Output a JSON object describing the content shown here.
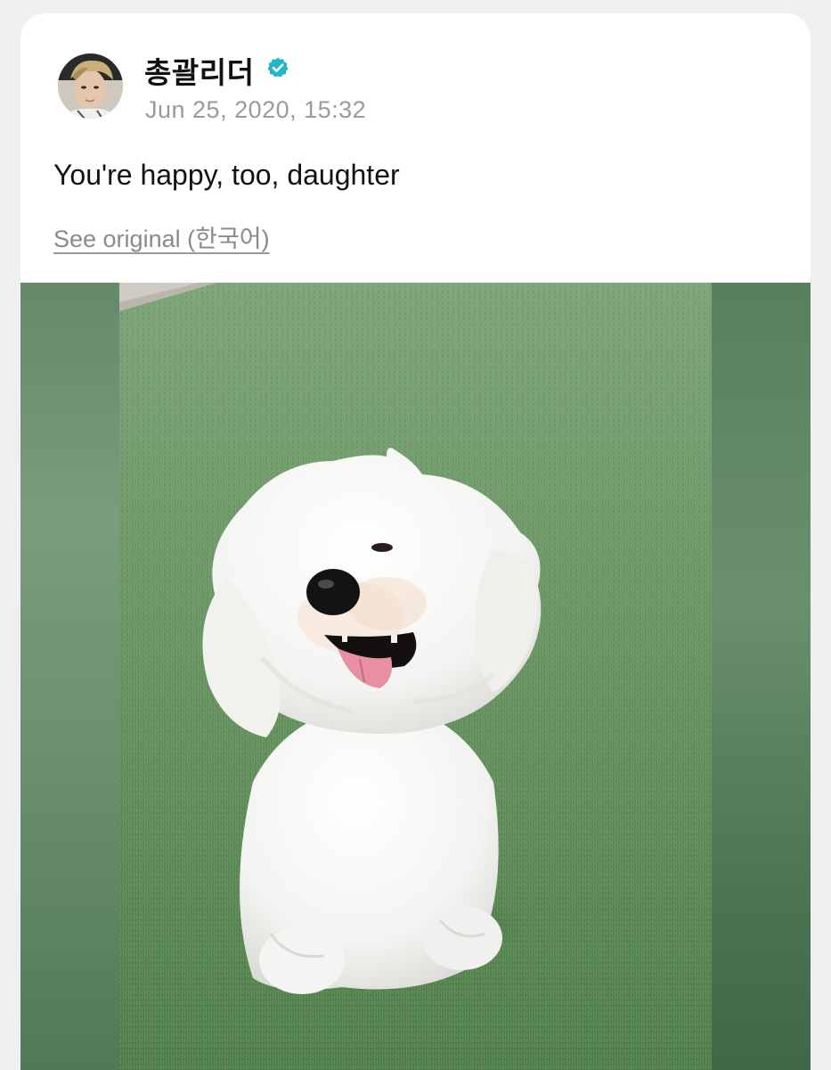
{
  "post": {
    "author_name": "총괄리더",
    "verified_icon": "verified-badge-icon",
    "timestamp": "Jun 25, 2020, 15:32",
    "text": "You're happy, too, daughter",
    "see_original_label": "See original (한국어)"
  },
  "colors": {
    "verified": "#21b6c7",
    "grass": "#5f8f5a",
    "accent_text": "#8a8a8a"
  },
  "media": {
    "type": "photo",
    "avatar_icon": "profile-avatar",
    "subject_icon": "white-dog-on-grass"
  }
}
